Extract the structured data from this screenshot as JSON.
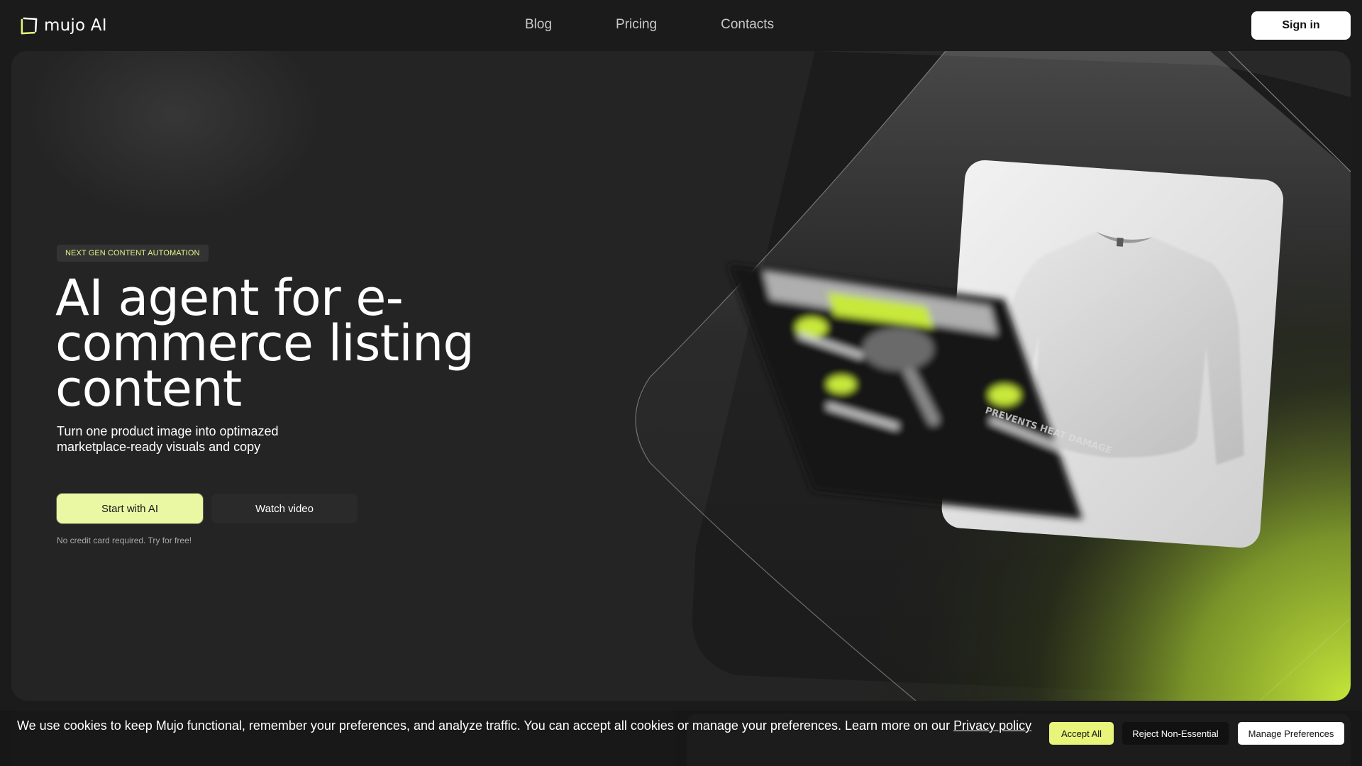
{
  "brand": {
    "name": "mujo AI",
    "logo_icon": "mujo-logo-icon",
    "accent": "#e8f57a"
  },
  "nav": {
    "items": [
      {
        "label": "Blog"
      },
      {
        "label": "Pricing"
      },
      {
        "label": "Contacts"
      }
    ]
  },
  "header": {
    "signin_label": "Sign in"
  },
  "hero": {
    "badge": "NEXT GEN CONTENT AUTOMATION",
    "headline": "AI agent for e-commerce listing content",
    "subheadline": "Turn one product image into optimazed marketplace-ready visuals and copy",
    "primary_cta": "Start with AI",
    "secondary_cta": "Watch video",
    "note": "No credit card required. Try for free!",
    "illustration_card_text": "PREVENTS HEAT DAMAGE"
  },
  "cookie": {
    "text": "We use cookies to keep Mujo functional, remember your preferences, and analyze traffic. You can accept all cookies or manage your preferences. Learn more on our",
    "link": "Privacy policy",
    "accept": "Accept All",
    "reject": "Reject Non-Essential",
    "manage": "Manage Preferences"
  },
  "colors": {
    "background": "#1b1b1b",
    "hero_panel": "#242424",
    "primary_button": "#eaf7a3",
    "lime_glow": "#c5e63a"
  }
}
